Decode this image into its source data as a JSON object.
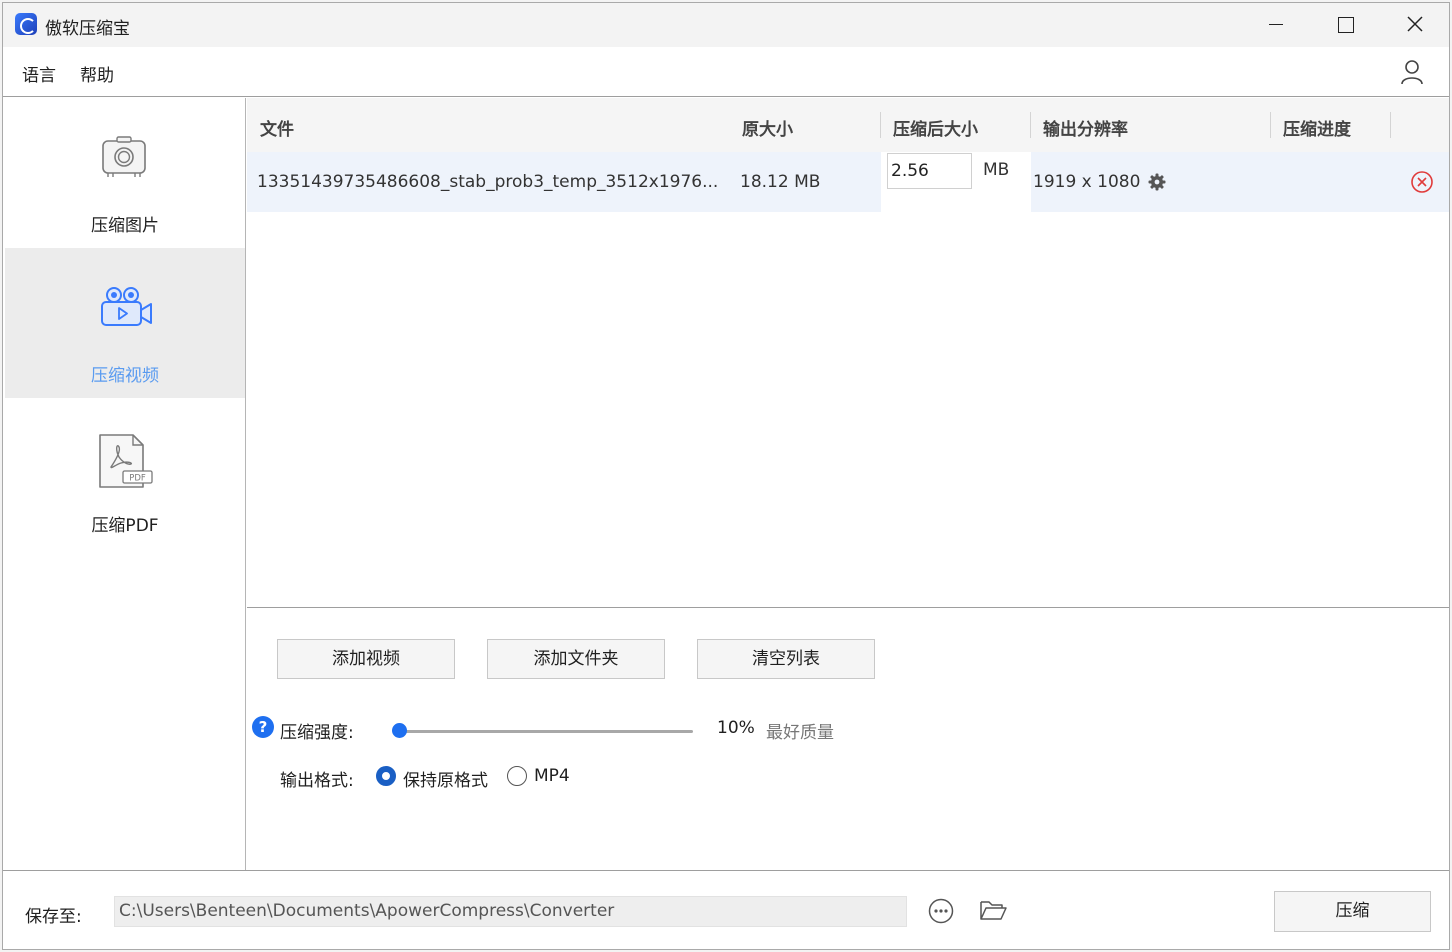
{
  "window": {
    "title": "傲软压缩宝"
  },
  "menu": {
    "items": [
      "语言",
      "帮助"
    ]
  },
  "sidebar": {
    "items": [
      {
        "label": "压缩图片",
        "icon": "camera-icon"
      },
      {
        "label": "压缩视频",
        "icon": "video-camera-icon",
        "active": true
      },
      {
        "label": "压缩PDF",
        "icon": "pdf-file-icon"
      }
    ]
  },
  "table": {
    "columns": [
      "文件",
      "原大小",
      "压缩后大小",
      "输出分辨率",
      "压缩进度"
    ],
    "rows": [
      {
        "file": "13351439735486608_stab_prob3_temp_3512x1976...",
        "original_size": "18.12 MB",
        "compressed_size": "2.56",
        "compressed_unit": "MB",
        "resolution": "1919 x 1080"
      }
    ]
  },
  "buttons": {
    "add_video": "添加视频",
    "add_folder": "添加文件夹",
    "clear_list": "清空列表"
  },
  "compression": {
    "label": "压缩强度:",
    "percent": "10%",
    "value": 0.1,
    "quality_text": "最好质量"
  },
  "output_format": {
    "label": "输出格式:",
    "options": [
      "保持原格式",
      "MP4"
    ],
    "selected": "保持原格式"
  },
  "footer": {
    "save_label": "保存至:",
    "path": "C:\\Users\\Benteen\\Documents\\ApowerCompress\\Converter",
    "compress_button": "压缩"
  },
  "colors": {
    "accent": "#1e6ff0",
    "active_text": "#5a9bf0",
    "remove": "#e03b3b"
  }
}
